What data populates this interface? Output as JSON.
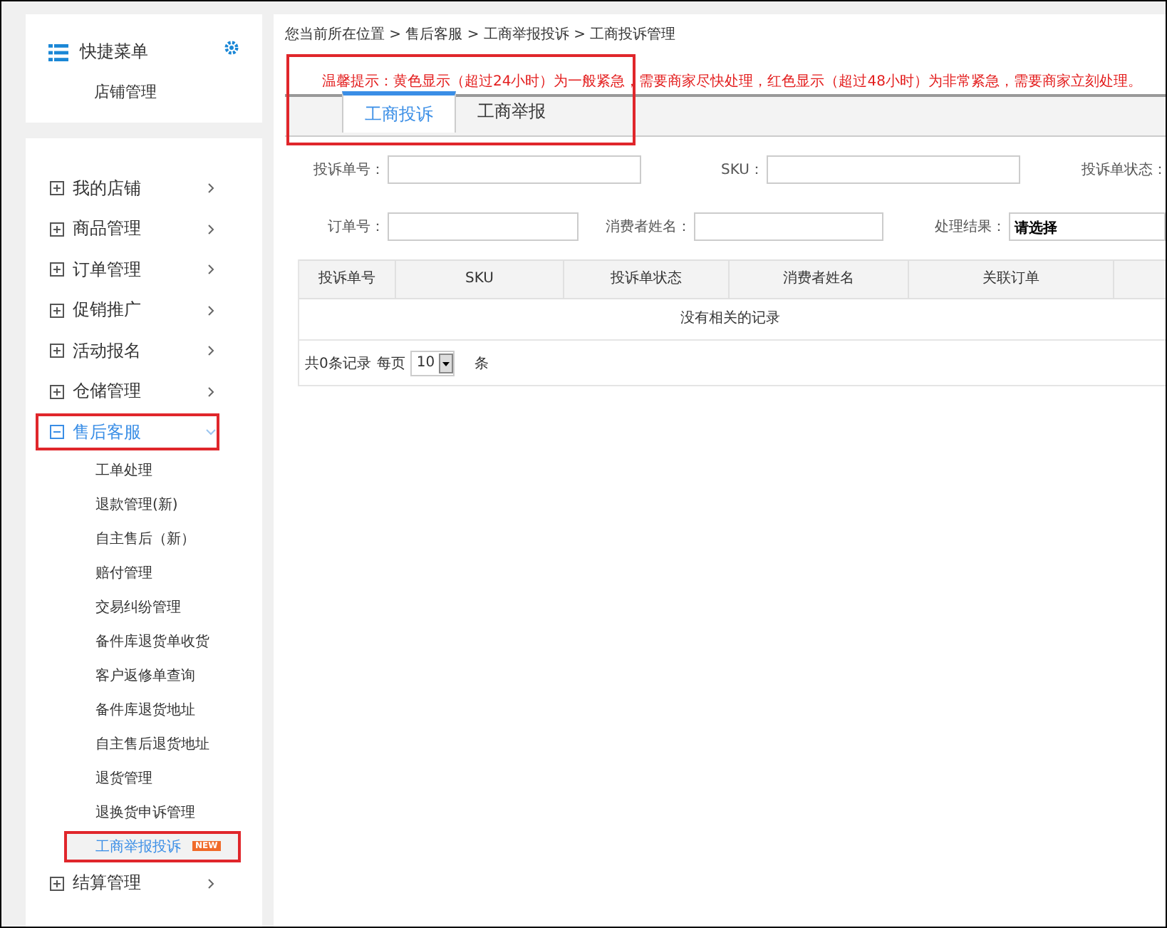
{
  "quick_menu": {
    "title": "快捷菜单",
    "items": [
      "店铺管理"
    ]
  },
  "nav": [
    {
      "label": "我的店铺",
      "expanded": false,
      "highlighted": false
    },
    {
      "label": "商品管理",
      "expanded": false,
      "highlighted": false
    },
    {
      "label": "订单管理",
      "expanded": false,
      "highlighted": false
    },
    {
      "label": "促销推广",
      "expanded": false,
      "highlighted": false
    },
    {
      "label": "活动报名",
      "expanded": false,
      "highlighted": false
    },
    {
      "label": "仓储管理",
      "expanded": false,
      "highlighted": false
    },
    {
      "label": "售后客服",
      "expanded": true,
      "highlighted": true,
      "children": [
        {
          "label": "工单处理",
          "selected": false,
          "highlighted": false
        },
        {
          "label": "退款管理(新)",
          "selected": false,
          "highlighted": false
        },
        {
          "label": "自主售后（新）",
          "selected": false,
          "highlighted": false
        },
        {
          "label": "赔付管理",
          "selected": false,
          "highlighted": false
        },
        {
          "label": "交易纠纷管理",
          "selected": false,
          "highlighted": false
        },
        {
          "label": "备件库退货单收货",
          "selected": false,
          "highlighted": false
        },
        {
          "label": "客户返修单查询",
          "selected": false,
          "highlighted": false
        },
        {
          "label": "备件库退货地址",
          "selected": false,
          "highlighted": false
        },
        {
          "label": "自主售后退货地址",
          "selected": false,
          "highlighted": false
        },
        {
          "label": "退货管理",
          "selected": false,
          "highlighted": false
        },
        {
          "label": "退换货申诉管理",
          "selected": false,
          "highlighted": false
        },
        {
          "label": "工商举报投诉",
          "selected": true,
          "highlighted": true,
          "badge": "NEW"
        }
      ]
    },
    {
      "label": "结算管理",
      "expanded": false,
      "highlighted": false
    }
  ],
  "breadcrumb": "您当前所在位置 > 售后客服 > 工商举报投诉 > 工商投诉管理",
  "notice": {
    "text": "温馨提示：黄色显示（超过24小时）为一般紧急，需要商家尽快处理，红色显示（超过48小时）为非常紧急，需要商家立刻处理。",
    "highlighted": true
  },
  "tabs": [
    {
      "label": "工商投诉",
      "selected": true
    },
    {
      "label": "工商举报",
      "selected": false
    }
  ],
  "filters": [
    [
      {
        "label": "投诉单号：",
        "kind": "input"
      },
      {
        "label": "SKU：",
        "kind": "input"
      },
      {
        "label": "投诉单状态：",
        "kind": "label"
      }
    ],
    [
      {
        "label": "订单号：",
        "kind": "input"
      },
      {
        "label": "消费者姓名：",
        "kind": "input"
      },
      {
        "label": "处理结果：",
        "kind": "select",
        "value": "请选择"
      }
    ]
  ],
  "table": {
    "columns": [
      "投诉单号",
      "SKU",
      "投诉单状态",
      "消费者姓名",
      "关联订单"
    ],
    "empty_message": "没有相关的记录"
  },
  "pagination": {
    "total": "共0条记录",
    "per_page_label": "每页",
    "per_page": "10",
    "unit": "条"
  }
}
